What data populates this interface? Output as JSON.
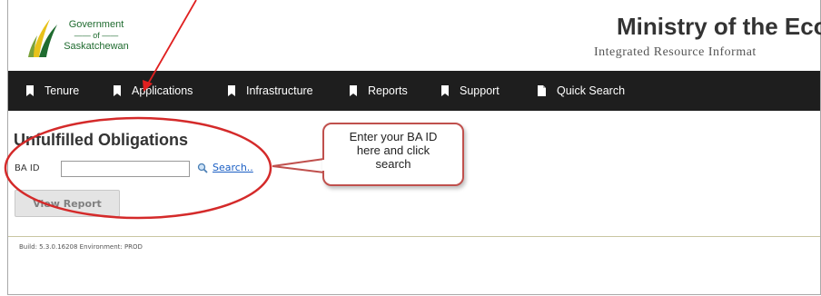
{
  "header": {
    "logo": {
      "line1": "Government",
      "line2": "of",
      "line3": "Saskatchewan"
    },
    "ministry_title": "Ministry of the Eco",
    "subtitle": "Integrated Resource Informat"
  },
  "nav": {
    "items": [
      {
        "label": "Tenure",
        "icon": "bookmark-icon"
      },
      {
        "label": "Applications",
        "icon": "bookmark-icon"
      },
      {
        "label": "Infrastructure",
        "icon": "bookmark-icon"
      },
      {
        "label": "Reports",
        "icon": "bookmark-icon"
      },
      {
        "label": "Support",
        "icon": "bookmark-icon"
      },
      {
        "label": "Quick Search",
        "icon": "document-icon"
      }
    ]
  },
  "main": {
    "title": "Unfulfilled Obligations",
    "ba_label": "BA ID",
    "ba_value": "",
    "search_label": "Search..",
    "view_button": "View Report"
  },
  "footer": {
    "build": "Build: 5.3.0.16208 Environment: PROD"
  },
  "annotation": {
    "callout_text": "Enter your BA ID\nhere and click\nsearch",
    "color": "#c0504d",
    "arrow_color": "#e02020"
  },
  "colors": {
    "navbar": "#1e1e1e",
    "logo_green": "#1f6b2f",
    "logo_yellow": "#e8c21a",
    "link": "#1b5fc4"
  }
}
